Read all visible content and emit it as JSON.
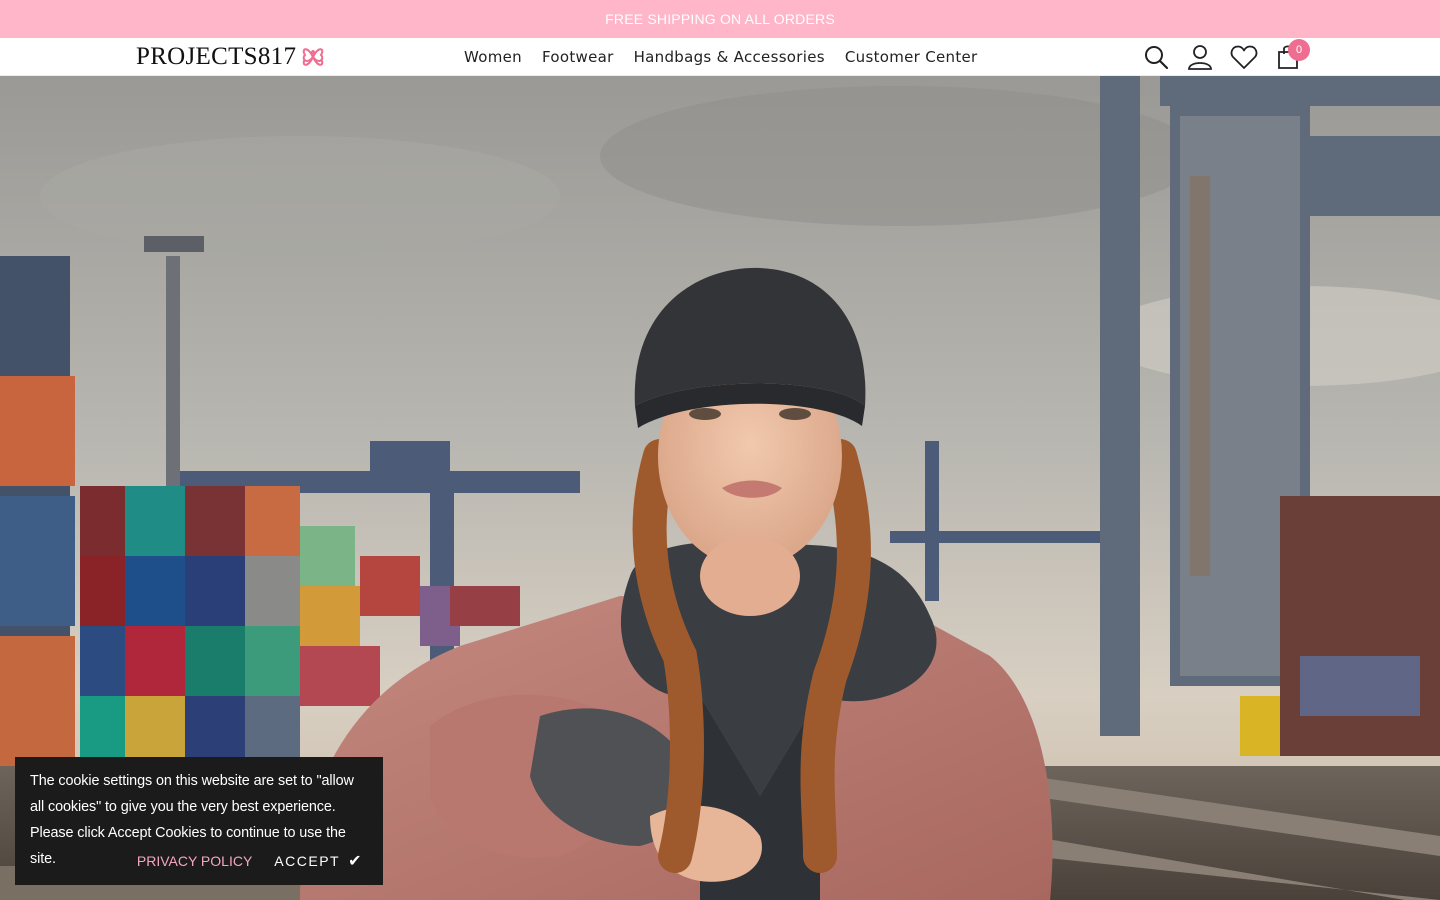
{
  "announcement": {
    "text": "FREE SHIPPING ON ALL ORDERS"
  },
  "header": {
    "logo_text": "PROJECTS817",
    "nav": [
      {
        "label": "Women"
      },
      {
        "label": "Footwear"
      },
      {
        "label": "Handbags & Accessories"
      },
      {
        "label": "Customer Center"
      }
    ],
    "icons": [
      "search-icon",
      "account-icon",
      "wishlist-icon",
      "cart-icon"
    ],
    "cart_count": "0"
  },
  "cookie_banner": {
    "message": "The cookie settings on this website are set to \"allow all cookies\" to give you the very best experience. Please click Accept Cookies to continue to use the site.",
    "privacy_label": "PRIVACY POLICY",
    "accept_label": "ACCEPT",
    "accept_icon": "check-icon"
  },
  "colors": {
    "announcement_bg": "#ffb6c9",
    "badge": "#f06d92",
    "privacy_link": "#f4a6bd",
    "cookie_bg": "#1b1b1b"
  }
}
